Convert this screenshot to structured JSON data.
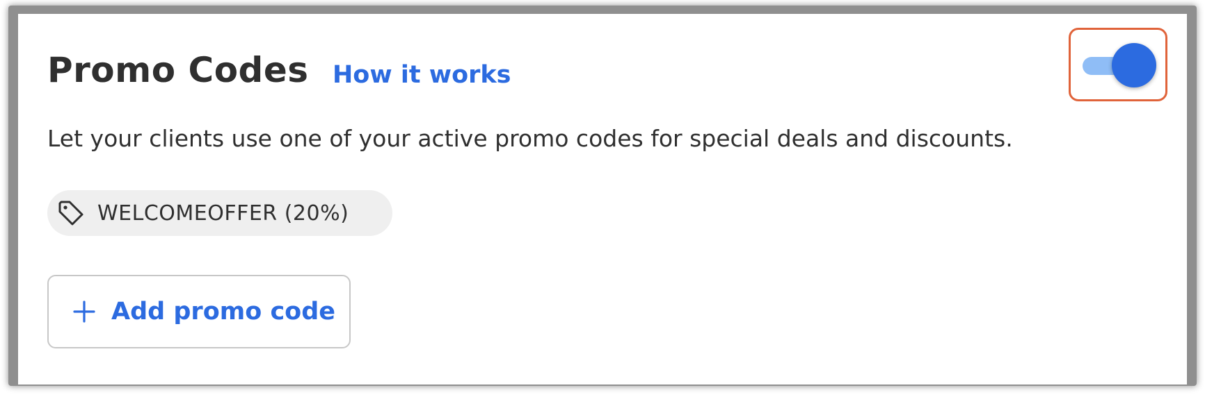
{
  "promo_codes": {
    "title": "Promo Codes",
    "how_it_works_link": "How it works",
    "description": "Let your clients use one of your active promo codes for special deals and discounts.",
    "toggle": {
      "enabled": true
    },
    "active_codes": [
      {
        "label": "WELCOMEOFFER (20%)",
        "icon": "tag-icon"
      }
    ],
    "add_button": {
      "label": "Add promo code",
      "icon": "plus-icon"
    }
  },
  "colors": {
    "accent": "#2c6be0",
    "accent_light": "#8fbdf6",
    "highlight_border": "#e0633a",
    "text": "#2f2f2f",
    "chip_bg": "#efefef"
  }
}
